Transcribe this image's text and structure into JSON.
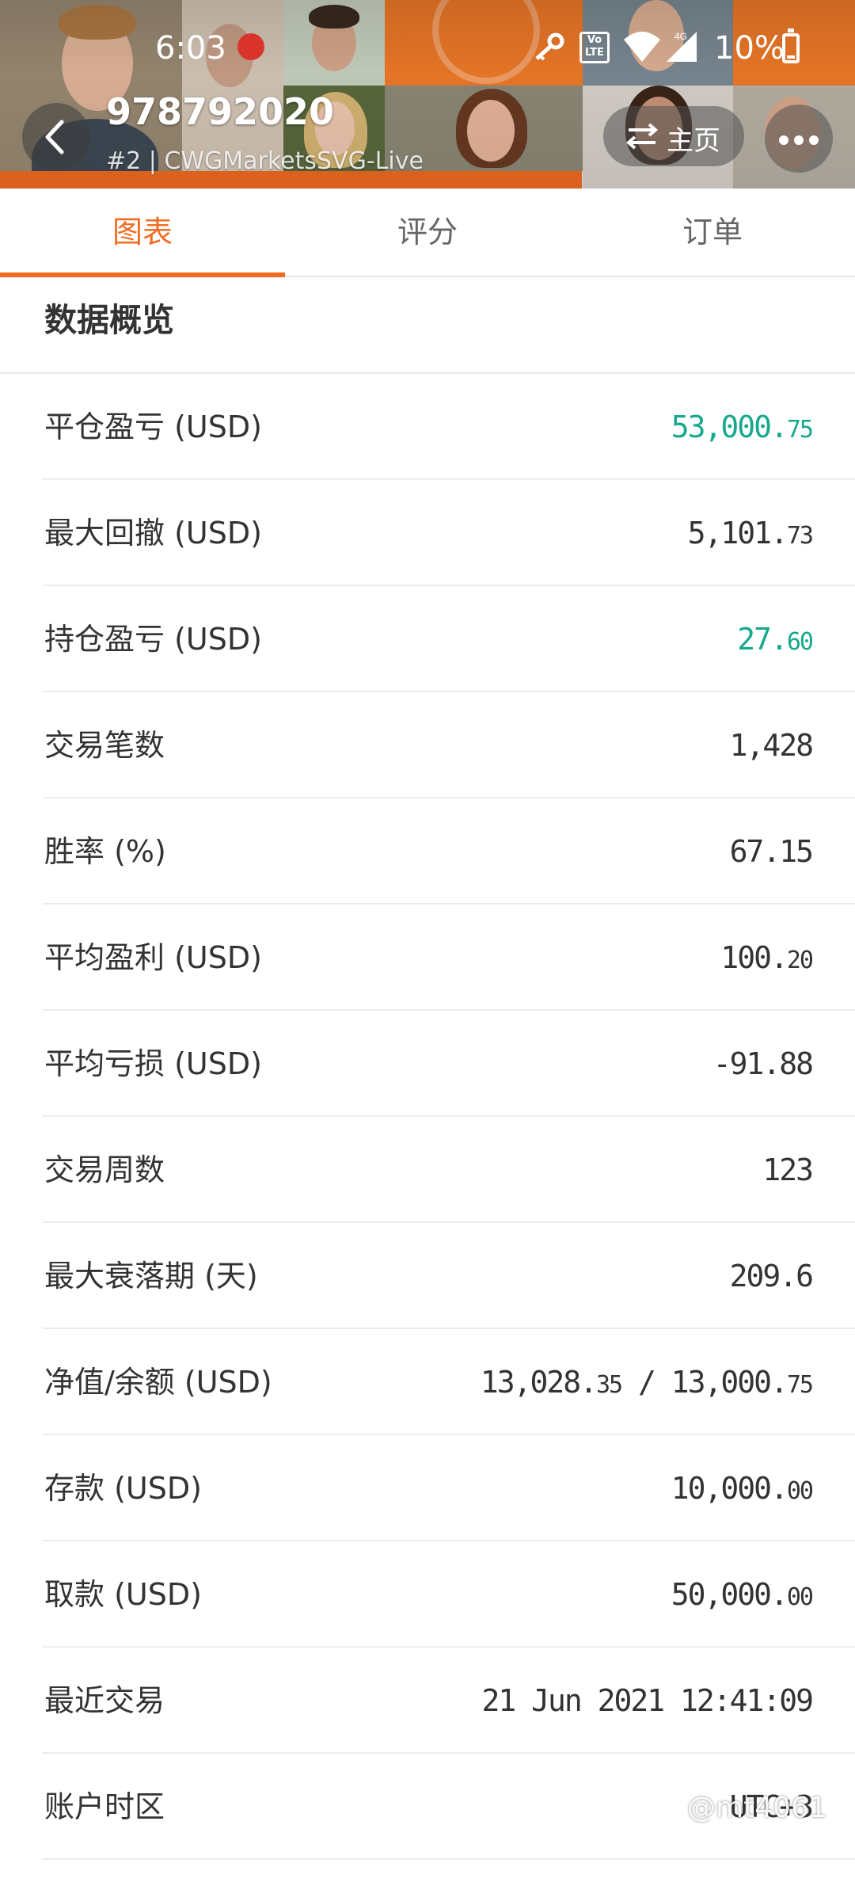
{
  "status_bar": {
    "time": "6:03",
    "battery": "10%",
    "network": "4G"
  },
  "header": {
    "account_id": "978792020",
    "subtitle": "#2 | CWGMarketsSVG-Live",
    "home_label": "主页",
    "accent_color": "#f26b21"
  },
  "tabs": [
    {
      "label": "图表",
      "active": true
    },
    {
      "label": "评分",
      "active": false
    },
    {
      "label": "订单",
      "active": false
    }
  ],
  "section": {
    "title": "数据概览"
  },
  "rows": [
    {
      "label": "平仓盈亏 (USD)",
      "value_main": "53,000.",
      "value_small": "75",
      "color": "#17a88e"
    },
    {
      "label": "最大回撤 (USD)",
      "value_main": "5,101.",
      "value_small": "73",
      "color": "#333333"
    },
    {
      "label": "持仓盈亏 (USD)",
      "value_main": "27.",
      "value_small": "60",
      "color": "#17a88e"
    },
    {
      "label": "交易笔数",
      "value_main": "1,428",
      "value_small": "",
      "color": "#333333"
    },
    {
      "label": "胜率 (%)",
      "value_main": "67.15",
      "value_small": "",
      "color": "#333333"
    },
    {
      "label": "平均盈利 (USD)",
      "value_main": "100.",
      "value_small": "20",
      "color": "#333333"
    },
    {
      "label": "平均亏损 (USD)",
      "value_main": "-91.88",
      "value_small": "",
      "color": "#333333"
    },
    {
      "label": "交易周数",
      "value_main": "123",
      "value_small": "",
      "color": "#333333"
    },
    {
      "label": "最大衰落期 (天)",
      "value_main": "209.6",
      "value_small": "",
      "color": "#333333"
    },
    {
      "label": "净值/余额 (USD)",
      "value_main": "13,028.",
      "value_small": "35",
      "value_main2": " / 13,000.",
      "value_small2": "75",
      "color": "#333333"
    },
    {
      "label": "存款 (USD)",
      "value_main": "10,000.",
      "value_small": "00",
      "color": "#333333"
    },
    {
      "label": "取款 (USD)",
      "value_main": "50,000.",
      "value_small": "00",
      "color": "#333333"
    },
    {
      "label": "最近交易",
      "value_main": "21 Jun 2021 12:41:09",
      "value_small": "",
      "color": "#333333"
    },
    {
      "label": "账户时区",
      "value_main": "UTC+3",
      "value_small": "",
      "color": "#333333"
    }
  ],
  "watermark": "@mt4061"
}
